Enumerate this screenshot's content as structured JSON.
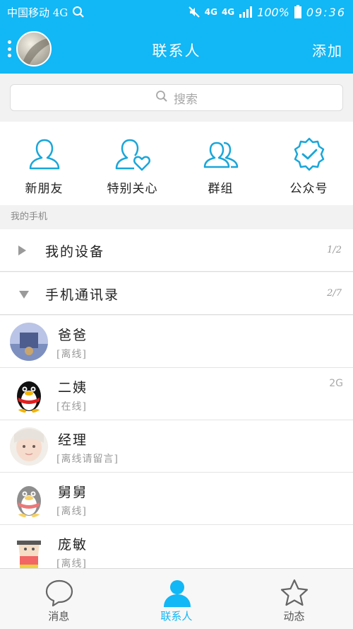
{
  "status_bar": {
    "carrier": "中国移动 4G",
    "network_1": "4G",
    "network_2": "4G",
    "battery": "100%",
    "time": "09:36"
  },
  "header": {
    "title": "联系人",
    "add_label": "添加"
  },
  "search": {
    "placeholder": "搜索"
  },
  "quick_entries": [
    {
      "label": "新朋友",
      "icon": "new-friend-icon"
    },
    {
      "label": "特别关心",
      "icon": "special-care-icon"
    },
    {
      "label": "群组",
      "icon": "group-icon"
    },
    {
      "label": "公众号",
      "icon": "official-account-icon"
    }
  ],
  "section_label": "我的手机",
  "groups": [
    {
      "name": "我的设备",
      "count": "1/2",
      "expanded": false
    },
    {
      "name": "手机通讯录",
      "count": "2/7",
      "expanded": true
    }
  ],
  "contacts": [
    {
      "name": "爸爸",
      "status": "[离线]",
      "network": ""
    },
    {
      "name": "二姨",
      "status": "[在线]",
      "network": "2G"
    },
    {
      "name": "经理",
      "status": "[离线请留言]",
      "network": ""
    },
    {
      "name": "舅舅",
      "status": "[离线]",
      "network": ""
    },
    {
      "name": "庞敏",
      "status": "[离线]",
      "network": ""
    }
  ],
  "tabs": [
    {
      "label": "消息",
      "icon": "chat-bubble-icon",
      "active": false
    },
    {
      "label": "联系人",
      "icon": "contacts-icon",
      "active": true
    },
    {
      "label": "动态",
      "icon": "star-icon",
      "active": false
    }
  ],
  "colors": {
    "accent": "#12b7f5",
    "background": "#f2f2f2",
    "text_muted": "#9a9a9a"
  }
}
